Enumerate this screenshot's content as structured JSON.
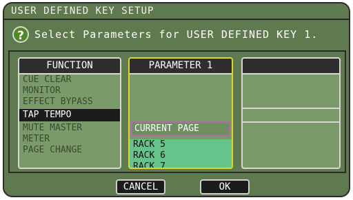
{
  "dialog": {
    "title": "USER DEFINED KEY SETUP",
    "prompt": "Select Parameters for USER DEFINED KEY 1."
  },
  "function_panel": {
    "header": "FUNCTION",
    "items": [
      "CUE CLEAR",
      "MONITOR",
      "EFFECT BYPASS",
      "TAP TEMPO",
      "MUTE MASTER",
      "METER",
      "PAGE CHANGE"
    ],
    "selected": "TAP TEMPO"
  },
  "parameter_panel": {
    "header": "PARAMETER 1",
    "current": "CURRENT PAGE",
    "items": [
      "RACK 5",
      "RACK 6",
      "RACK 7"
    ]
  },
  "buttons": {
    "cancel": "CANCEL",
    "ok": "OK"
  },
  "icons": {
    "help": "question-circle-icon"
  },
  "colors": {
    "background": "#5f7a4e",
    "selected": "#1c1c1c",
    "parameter_list": "#66c38a",
    "parameter_border": "#e0d62a",
    "current_border": "#b46aa8"
  }
}
